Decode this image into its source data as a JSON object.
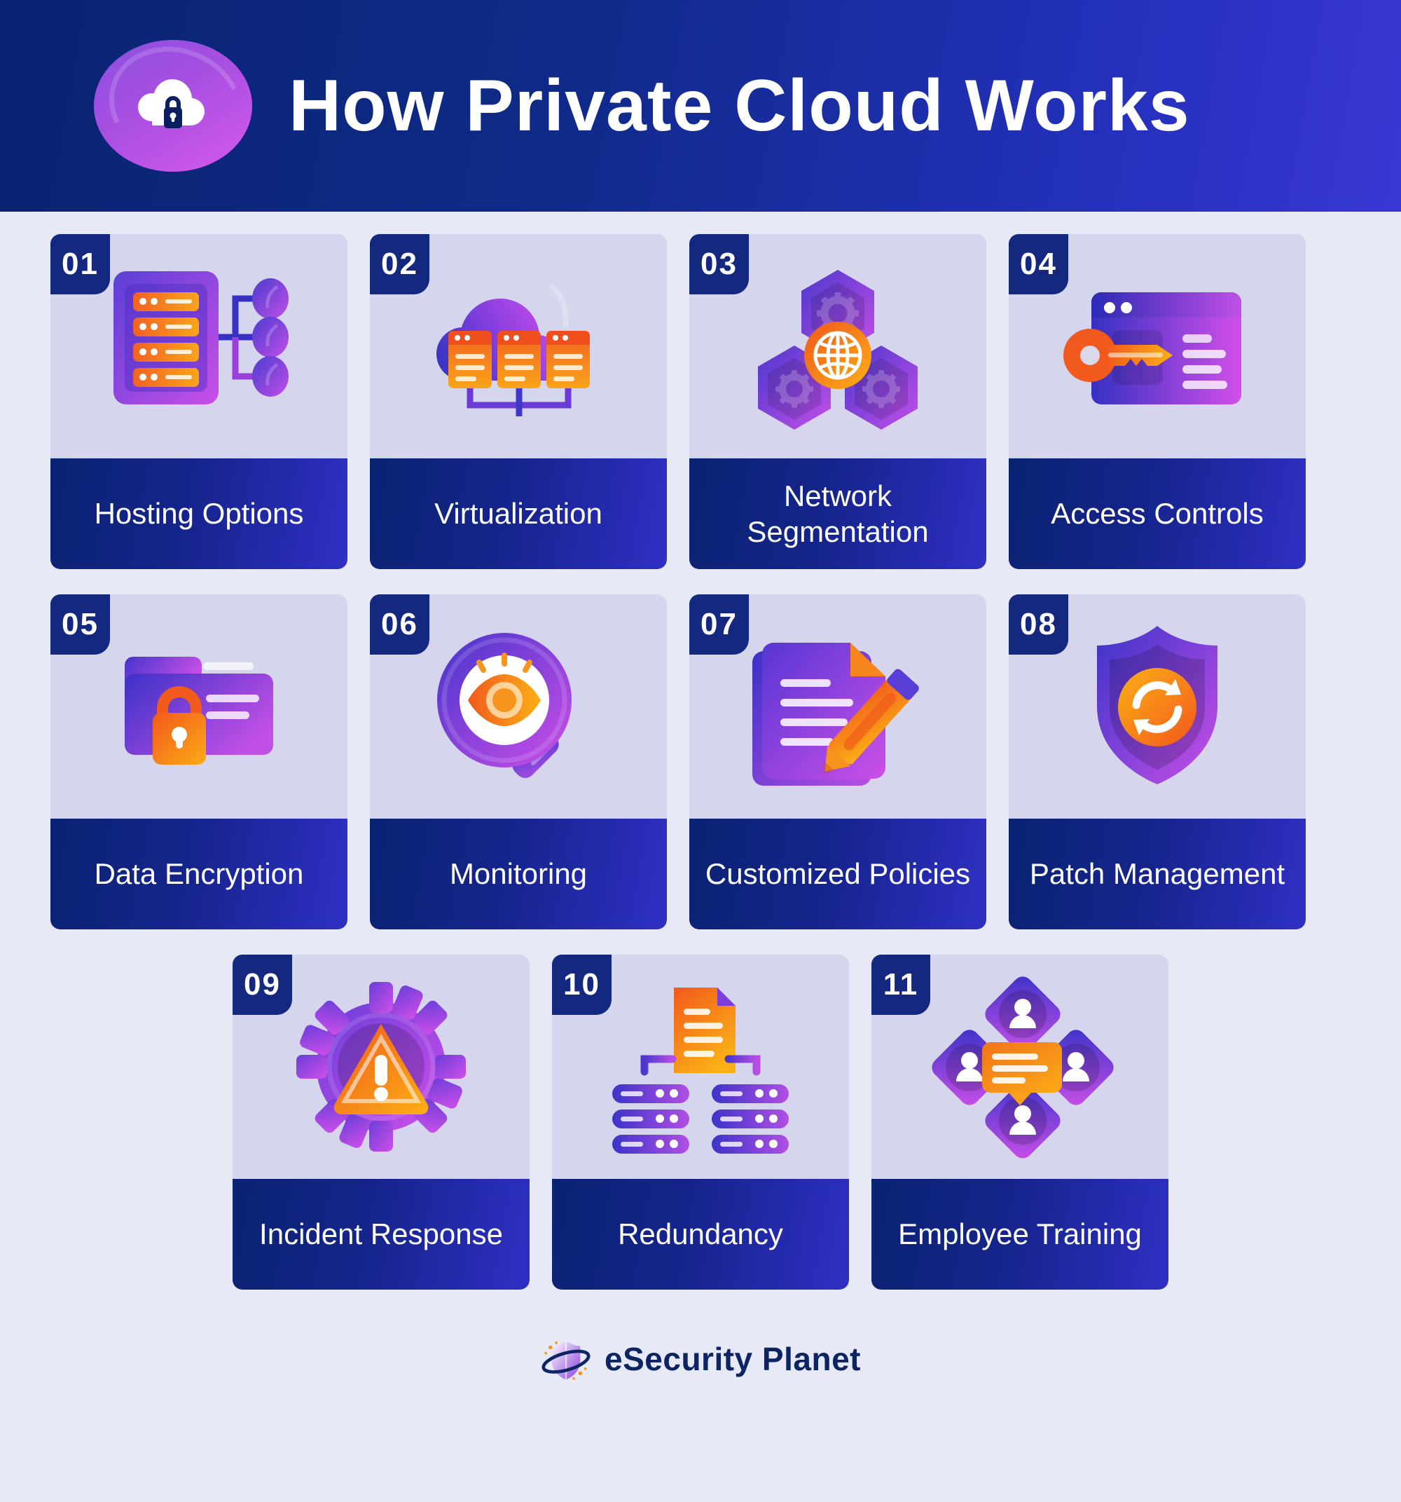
{
  "header": {
    "title": "How Private Cloud Works",
    "logo_icon": "cloud-lock-icon",
    "bg_color_start": "#0a2372",
    "bg_color_end": "#3937d4"
  },
  "theme": {
    "page_bg": "#e8e9f6",
    "card_visual_bg": "#d5d6ed",
    "label_gradient_start": "#0a2372",
    "label_gradient_end": "#2f2fc4",
    "badge_bg": "#13287e",
    "accent_purple": "#8b3fe0",
    "accent_orange": "#f7941e",
    "accent_orange_dark": "#f26122"
  },
  "cards": [
    {
      "number": "01",
      "label": "Hosting Options",
      "icon": "server-rack-nodes-icon"
    },
    {
      "number": "02",
      "label": "Virtualization",
      "icon": "cloud-servers-icon"
    },
    {
      "number": "03",
      "label": "Network Segmentation",
      "icon": "hexagon-gears-globe-icon"
    },
    {
      "number": "04",
      "label": "Access Controls",
      "icon": "key-browser-window-icon"
    },
    {
      "number": "05",
      "label": "Data Encryption",
      "icon": "folder-lock-icon"
    },
    {
      "number": "06",
      "label": "Monitoring",
      "icon": "magnifier-eye-icon"
    },
    {
      "number": "07",
      "label": "Customized Policies",
      "icon": "document-pencil-icon"
    },
    {
      "number": "08",
      "label": "Patch Management",
      "icon": "shield-refresh-icon"
    },
    {
      "number": "09",
      "label": "Incident Response",
      "icon": "gear-warning-icon"
    },
    {
      "number": "10",
      "label": "Redundancy",
      "icon": "document-servers-icon"
    },
    {
      "number": "11",
      "label": "Employee Training",
      "icon": "diamond-users-chat-icon"
    }
  ],
  "footer": {
    "brand": "eSecurity Planet",
    "logo_icon": "shield-orbit-icon"
  }
}
